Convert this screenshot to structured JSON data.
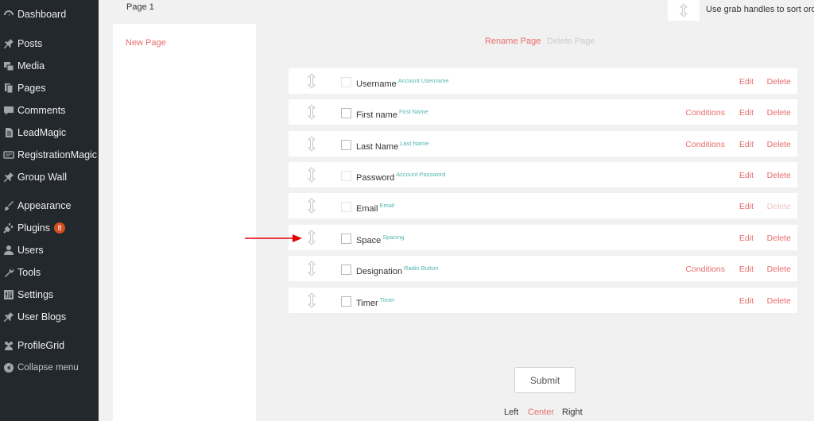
{
  "sidebar": {
    "items": [
      {
        "label": "Dashboard",
        "icon": "dashboard-icon"
      },
      {
        "label": "Posts",
        "icon": "pin-icon"
      },
      {
        "label": "Media",
        "icon": "media-icon"
      },
      {
        "label": "Pages",
        "icon": "pages-icon"
      },
      {
        "label": "Comments",
        "icon": "comment-icon"
      },
      {
        "label": "LeadMagic",
        "icon": "document-icon"
      },
      {
        "label": "RegistrationMagic",
        "icon": "form-icon"
      },
      {
        "label": "Group Wall",
        "icon": "pin-icon"
      },
      {
        "label": "Appearance",
        "icon": "brush-icon"
      },
      {
        "label": "Plugins",
        "icon": "plug-icon",
        "badge": "8"
      },
      {
        "label": "Users",
        "icon": "user-icon"
      },
      {
        "label": "Tools",
        "icon": "wrench-icon"
      },
      {
        "label": "Settings",
        "icon": "settings-icon"
      },
      {
        "label": "User Blogs",
        "icon": "pin-icon"
      },
      {
        "label": "ProfileGrid",
        "icon": "group-icon"
      },
      {
        "label": "Collapse menu",
        "icon": "collapse-icon"
      }
    ]
  },
  "pages": {
    "current_tab": "Page 1",
    "new_page": "New Page",
    "rename": "Rename Page",
    "delete": "Delete Page"
  },
  "hint": "Use grab handles to sort order",
  "fields": [
    {
      "label": "Username",
      "type": "Account Username",
      "conditions": "",
      "edit": "Edit",
      "delete": "Delete",
      "checkbox_disabled": true,
      "delete_disabled": false
    },
    {
      "label": "First name",
      "type": "First Name",
      "conditions": "Conditions",
      "edit": "Edit",
      "delete": "Delete",
      "checkbox_disabled": false,
      "delete_disabled": false
    },
    {
      "label": "Last Name",
      "type": "Last Name",
      "conditions": "Conditions",
      "edit": "Edit",
      "delete": "Delete",
      "checkbox_disabled": false,
      "delete_disabled": false
    },
    {
      "label": "Password",
      "type": "Account Password",
      "conditions": "",
      "edit": "Edit",
      "delete": "Delete",
      "checkbox_disabled": true,
      "delete_disabled": false
    },
    {
      "label": "Email",
      "type": "Email",
      "conditions": "",
      "edit": "Edit",
      "delete": "Delete",
      "checkbox_disabled": true,
      "delete_disabled": true
    },
    {
      "label": "Space",
      "type": "Spacing",
      "conditions": "",
      "edit": "Edit",
      "delete": "Delete",
      "checkbox_disabled": false,
      "delete_disabled": false
    },
    {
      "label": "Designation",
      "type": "Radio Button",
      "conditions": "Conditions",
      "edit": "Edit",
      "delete": "Delete",
      "checkbox_disabled": false,
      "delete_disabled": false
    },
    {
      "label": "Timer",
      "type": "Timer",
      "conditions": "",
      "edit": "Edit",
      "delete": "Delete",
      "checkbox_disabled": false,
      "delete_disabled": false
    }
  ],
  "submit": "Submit",
  "alignment": {
    "left": "Left",
    "center": "Center",
    "right": "Right",
    "selected": "Center"
  },
  "colors": {
    "sidebar_bg": "#23282d",
    "accent": "#e86b6b",
    "field_type": "#4fb6b1",
    "annotation_arrow": "#e60000"
  }
}
